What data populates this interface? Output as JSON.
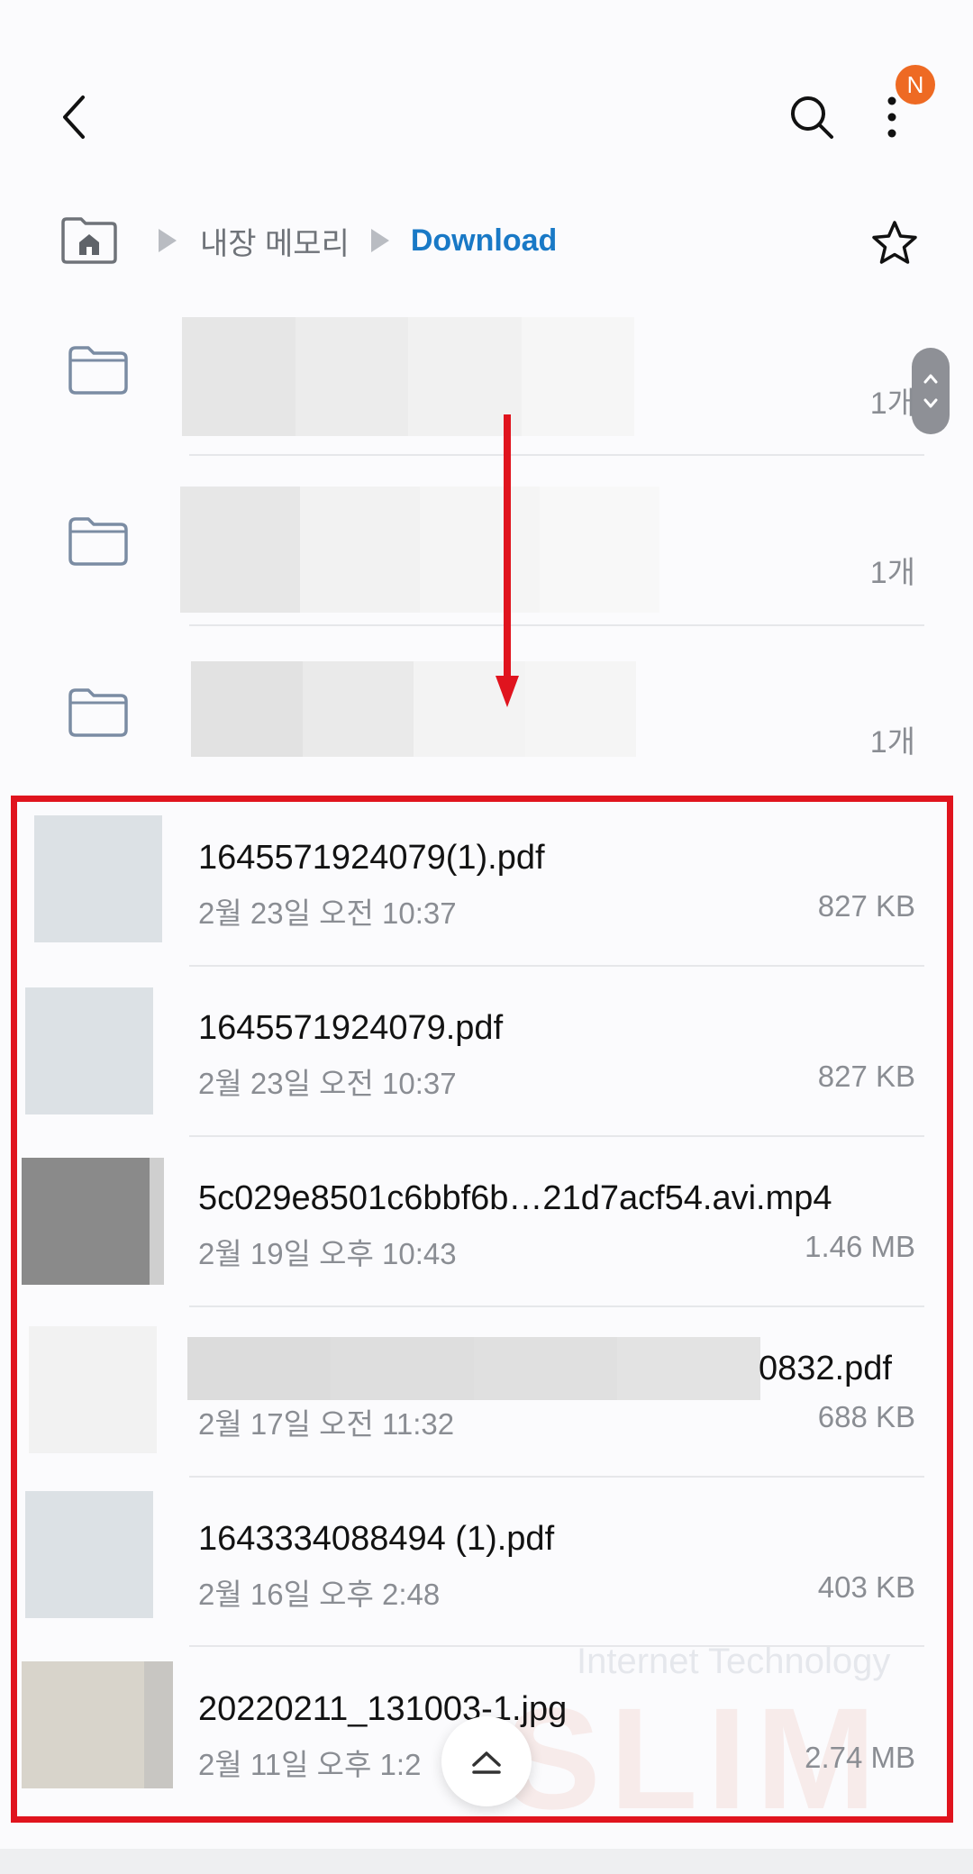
{
  "header": {
    "back_icon": "chevron-left-icon",
    "search_icon": "search-icon",
    "more_icon": "more-vertical-icon",
    "notification_badge": "N",
    "badge_color": "#ee6a23"
  },
  "breadcrumb": {
    "home_icon": "home-icon",
    "storage_label": "내장 메모리",
    "current_label": "Download",
    "current_color": "#1979c6",
    "favorite_icon": "star-icon"
  },
  "folders": [
    {
      "count": "1개"
    },
    {
      "count": "1개"
    },
    {
      "count": "1개"
    }
  ],
  "files": [
    {
      "name": "1645571924079(1).pdf",
      "date": "2월 23일 오전 10:37",
      "size": "827 KB"
    },
    {
      "name": "1645571924079.pdf",
      "date": "2월 23일 오전 10:37",
      "size": "827 KB"
    },
    {
      "name": "5c029e8501c6bbf6b…21d7acf54.avi.mp4",
      "date": "2월 19일 오후 10:43",
      "size": "1.46 MB"
    },
    {
      "name": "0832.pdf",
      "date": "2월 17일 오전 11:32",
      "size": "688 KB"
    },
    {
      "name": "1643334088494 (1).pdf",
      "date": "2월 16일 오후 2:48",
      "size": "403 KB"
    },
    {
      "name": "20220211_131003-1.jpg",
      "date": "2월 11일 오후 1:2",
      "size": "2.74 MB"
    }
  ],
  "watermark": {
    "tagline": "Internet Technology",
    "brand": "SLIM"
  },
  "annotation_color": "#e0141e",
  "scroll_top_icon": "chevron-up-icon"
}
